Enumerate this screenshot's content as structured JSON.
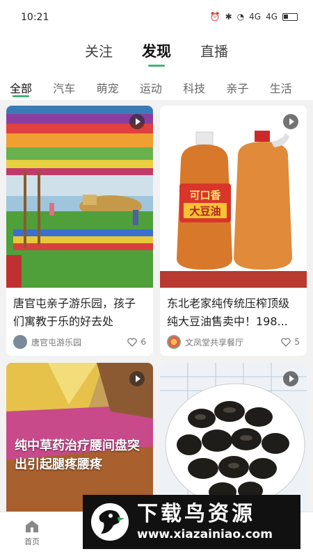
{
  "status_bar": {
    "time": "10:21",
    "signal1": "4G",
    "signal2": "4G"
  },
  "top_tabs": [
    {
      "label": "关注",
      "active": false
    },
    {
      "label": "发现",
      "active": true
    },
    {
      "label": "直播",
      "active": false
    }
  ],
  "categories": [
    {
      "label": "全部",
      "active": true
    },
    {
      "label": "汽车"
    },
    {
      "label": "萌宠"
    },
    {
      "label": "运动"
    },
    {
      "label": "科技"
    },
    {
      "label": "亲子"
    },
    {
      "label": "生活"
    }
  ],
  "cards": [
    {
      "title": "唐官屯亲子游乐园，孩子们寓教于乐的好去处",
      "author": "唐官屯游乐园",
      "likes": "6"
    },
    {
      "title": "东北老家纯传统压榨顶级纯大豆油售卖中！198...",
      "author": "文凤堂共享餐厅",
      "likes": "5",
      "label_big": "可口香",
      "label_sub": "大豆油"
    },
    {
      "overlay": "纯中草药治疗腰间盘突出引起腿疼腰疼"
    },
    {}
  ],
  "bottom_nav": {
    "home_label": "首页"
  },
  "watermark": {
    "title": "下载鸟资源",
    "url": "www.xiazainiao.com"
  },
  "colors": {
    "accent": "#43b37a"
  }
}
